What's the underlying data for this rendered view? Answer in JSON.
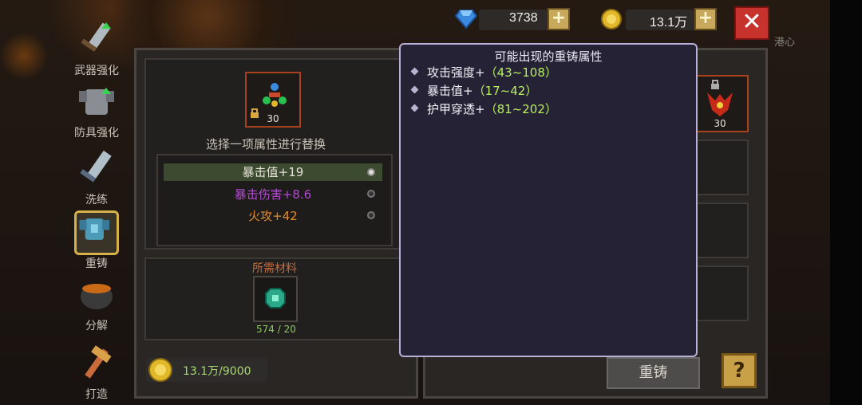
{
  "currency": {
    "gems": "3738",
    "gold": "13.1万"
  },
  "corner_label": "港心",
  "nav": [
    {
      "label": "武器强化",
      "icon": "sword-upgrade-icon"
    },
    {
      "label": "防具强化",
      "icon": "armor-upgrade-icon"
    },
    {
      "label": "洗练",
      "icon": "refine-sword-icon"
    },
    {
      "label": "重铸",
      "icon": "reforge-armor-icon",
      "active": true
    },
    {
      "label": "分解",
      "icon": "cauldron-icon"
    },
    {
      "label": "打造",
      "icon": "forge-hammer-icon"
    }
  ],
  "left_panel": {
    "item_count": "30",
    "instruction": "选择一项属性进行替换",
    "options": [
      {
        "label": "暴击值+19",
        "color": "#e6e2d8",
        "selected": true
      },
      {
        "label": "暴击伤害+8.6",
        "color": "#b04ad0",
        "selected": false
      },
      {
        "label": "火攻+42",
        "color": "#e08a2a",
        "selected": false
      }
    ],
    "materials_title": "所需材料",
    "material_count": "574 / 20",
    "cost": "13.1万/9000"
  },
  "right_panel": {
    "item_count": "30",
    "reforge_label": "重铸",
    "help_label": "?"
  },
  "popup": {
    "title": "可能出现的重铸属性",
    "attributes": [
      {
        "name": "攻击强度+",
        "range": "（43~108）"
      },
      {
        "name": "暴击值+",
        "range": "（17~42）"
      },
      {
        "name": "护甲穿透+",
        "range": "（81~202）"
      }
    ]
  }
}
